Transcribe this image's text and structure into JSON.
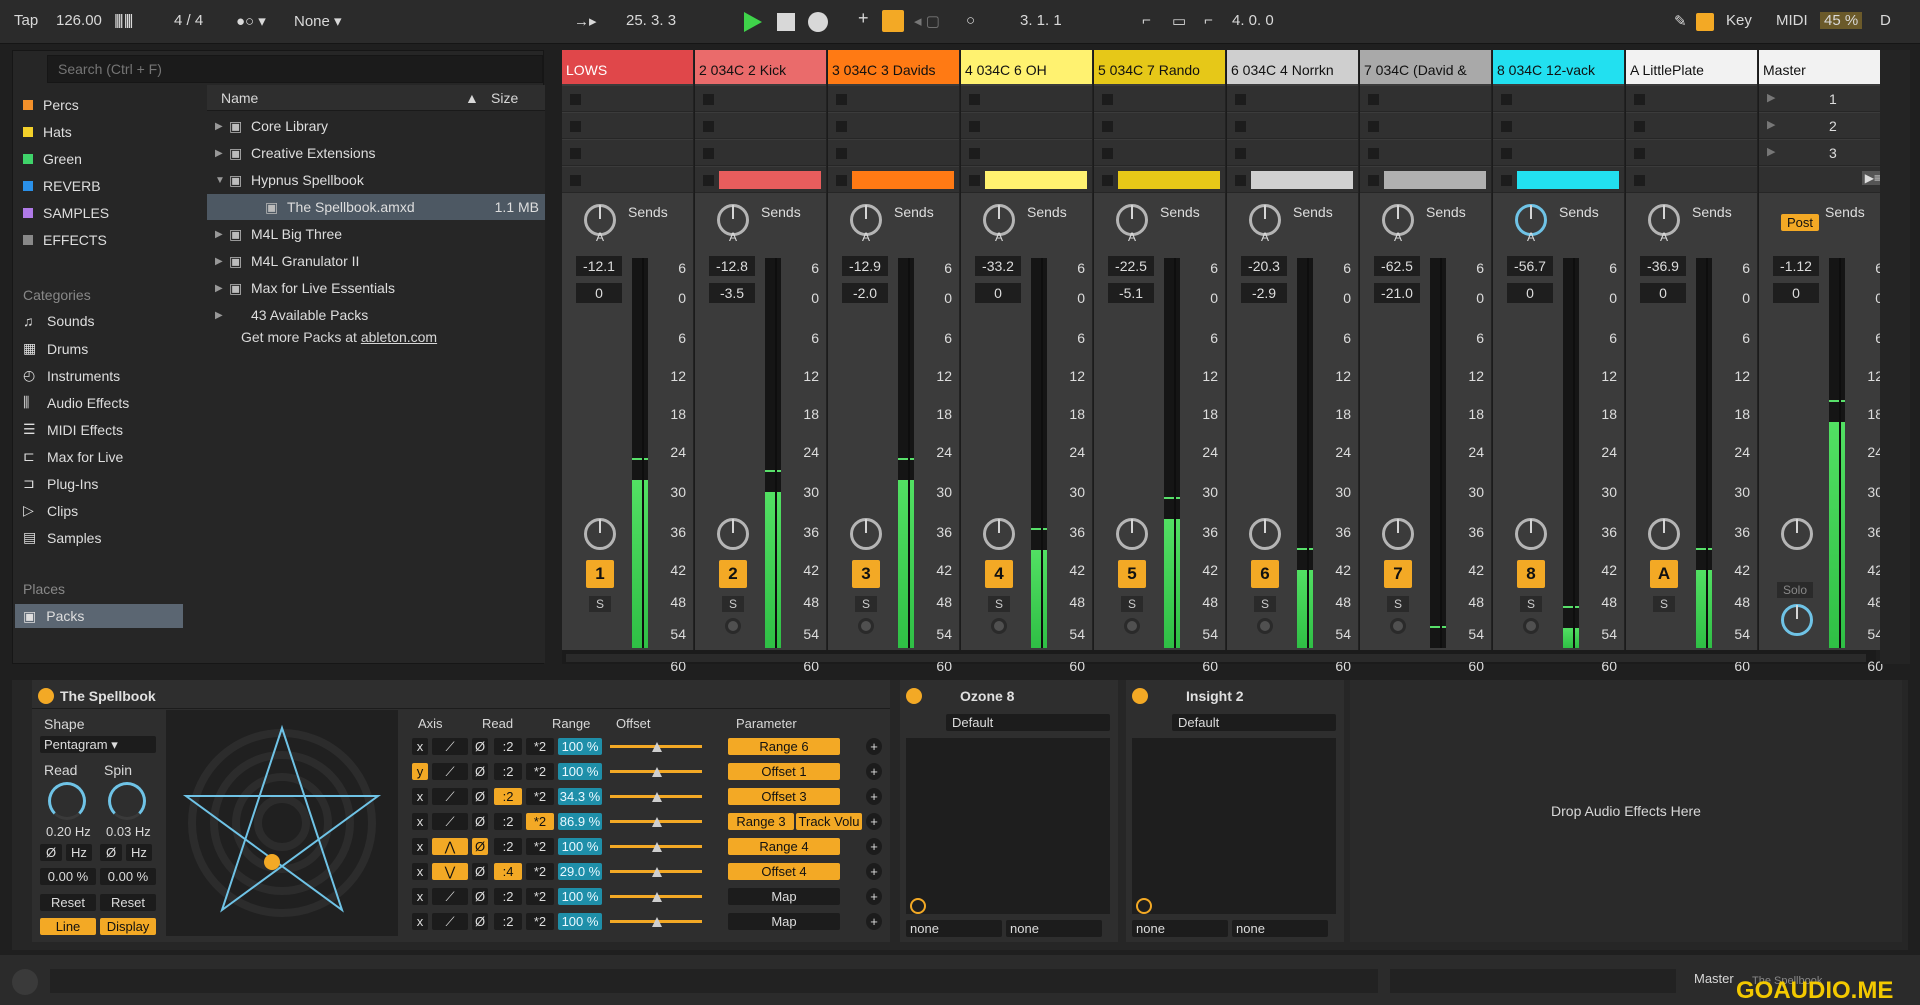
{
  "topbar": {
    "tap": "Tap",
    "tempo": "126.00",
    "signature": "4 / 4",
    "quantize": "None",
    "arrangement_position": "25.  3.  3",
    "loop_start": "3.  1.  1",
    "loop_length": "4.  0.  0",
    "key_label": "Key",
    "midi_label": "MIDI",
    "cpu": "45 %",
    "d_label": "D"
  },
  "browser": {
    "search_placeholder": "Search (Ctrl + F)",
    "collections": [
      {
        "label": "Percs",
        "color": "#f3902a"
      },
      {
        "label": "Hats",
        "color": "#f3d02a"
      },
      {
        "label": "Green",
        "color": "#3fd36a"
      },
      {
        "label": "REVERB",
        "color": "#2a90e8"
      },
      {
        "label": "SAMPLES",
        "color": "#b07ae8"
      },
      {
        "label": "EFFECTS",
        "color": "#888888"
      }
    ],
    "categories_heading": "Categories",
    "categories": [
      "Sounds",
      "Drums",
      "Instruments",
      "Audio Effects",
      "MIDI Effects",
      "Max for Live",
      "Plug-Ins",
      "Clips",
      "Samples"
    ],
    "places_heading": "Places",
    "places": [
      "Packs"
    ],
    "columns": {
      "name": "Name",
      "size": "Size"
    },
    "files": [
      {
        "label": "Core Library",
        "size": ""
      },
      {
        "label": "Creative Extensions",
        "size": ""
      },
      {
        "label": "Hypnus Spellbook",
        "size": ""
      },
      {
        "label": "The Spellbook.amxd",
        "size": "1.1 MB"
      },
      {
        "label": "M4L Big Three",
        "size": ""
      },
      {
        "label": "M4L Granulator II",
        "size": ""
      },
      {
        "label": "Max for Live Essentials",
        "size": ""
      },
      {
        "label": "43 Available Packs",
        "size": ""
      }
    ],
    "more_packs": "Get more Packs at",
    "more_packs_link": "ableton.com"
  },
  "mixer": {
    "sends_label": "Sends",
    "knob_letter": "A",
    "solo_label": "S",
    "post_label": "Post",
    "solo_master": "Solo",
    "scale": [
      "6",
      "0",
      "6",
      "12",
      "18",
      "24",
      "30",
      "36",
      "42",
      "48",
      "54",
      "60"
    ],
    "scene_numbers": [
      "1",
      "2",
      "3"
    ],
    "tracks": [
      {
        "name": "LOWS",
        "color": "#e0474a",
        "num": "1",
        "vol": "-12.1",
        "pan": "0",
        "clip": "",
        "level": 0.43
      },
      {
        "name": "2 034C 2 Kick",
        "color": "#ea6b6b",
        "num": "2",
        "vol": "-12.8",
        "pan": "-3.5",
        "clip": "#e85d5d",
        "level": 0.4
      },
      {
        "name": "3 034C 3 Davids",
        "color": "#ff7a14",
        "num": "3",
        "vol": "-12.9",
        "pan": "-2.0",
        "clip": "#ff7a14",
        "level": 0.43
      },
      {
        "name": "4 034C 6 OH",
        "color": "#fff270",
        "num": "4",
        "vol": "-33.2",
        "pan": "0",
        "clip": "#fff270",
        "level": 0.25
      },
      {
        "name": "5 034C 7 Rando",
        "color": "#e6c818",
        "num": "5",
        "vol": "-22.5",
        "pan": "-5.1",
        "clip": "#e6c818",
        "level": 0.33
      },
      {
        "name": "6 034C 4 Norrkn",
        "color": "#cfcfcf",
        "num": "6",
        "vol": "-20.3",
        "pan": "-2.9",
        "clip": "#d0d0d0",
        "level": 0.2
      },
      {
        "name": "7 034C (David &",
        "color": "#a9a9a9",
        "num": "7",
        "vol": "-62.5",
        "pan": "-21.0",
        "clip": "#b0b0b0",
        "level": 0.0
      },
      {
        "name": "8 034C 12-vack",
        "color": "#22e0f0",
        "num": "8",
        "vol": "-56.7",
        "pan": "0",
        "clip": "#22e0f0",
        "level": 0.05
      },
      {
        "name": "A LittlePlate",
        "color": "#f2f2f2",
        "num": "A",
        "vol": "-36.9",
        "pan": "0",
        "clip": "",
        "level": 0.2
      },
      {
        "name": "Master",
        "color": "#f2f2f2",
        "num": "",
        "vol": "-1.12",
        "pan": "0",
        "clip": "",
        "level": 0.58
      }
    ]
  },
  "devices": {
    "spellbook": {
      "title": "The Spellbook",
      "shape_label": "Shape",
      "shape_value": "Pentagram",
      "read_label": "Read",
      "spin_label": "Spin",
      "read_rate": "0.20 Hz",
      "spin_rate": "0.03 Hz",
      "phi": "Ø",
      "hz": "Hz",
      "read_pct": "0.00 %",
      "spin_pct": "0.00 %",
      "reset": "Reset",
      "line": "Line",
      "display": "Display",
      "headers": {
        "axis": "Axis",
        "read": "Read",
        "range": "Range",
        "offset": "Offset",
        "parameter": "Parameter"
      },
      "rows": [
        {
          "axis": "x",
          "div": ":2",
          "mul": "*2",
          "range": "100 %",
          "param": "Range 6",
          "param2": ""
        },
        {
          "axis": "y",
          "div": ":2",
          "mul": "*2",
          "range": "100 %",
          "param": "Offset 1",
          "param2": ""
        },
        {
          "axis": "x",
          "div": ":2",
          "mul": "*2",
          "range": "34.3 %",
          "param": "Offset 3",
          "param2": ""
        },
        {
          "axis": "x",
          "div": ":2",
          "mul": "*2",
          "range": "86.9 %",
          "param": "Range 3",
          "param2": "Track Volu"
        },
        {
          "axis": "x",
          "div": ":2",
          "mul": "*2",
          "range": "100 %",
          "param": "Range 4",
          "param2": ""
        },
        {
          "axis": "x",
          "div": ":4",
          "mul": "*2",
          "range": "29.0 %",
          "param": "Offset 4",
          "param2": ""
        },
        {
          "axis": "x",
          "div": ":2",
          "mul": "*2",
          "range": "100 %",
          "param": "Map",
          "param2": ""
        },
        {
          "axis": "x",
          "div": ":2",
          "mul": "*2",
          "range": "100 %",
          "param": "Map",
          "param2": ""
        }
      ]
    },
    "ozone": {
      "title": "Ozone 8",
      "preset": "Default",
      "in": "none",
      "out": "none"
    },
    "insight": {
      "title": "Insight 2",
      "preset": "Default",
      "in": "none",
      "out": "none"
    },
    "drop_hint": "Drop Audio Effects Here"
  },
  "status": {
    "master": "Master",
    "spellbook": "The Spellbook",
    "watermark": "GOAUDIO.ME"
  }
}
